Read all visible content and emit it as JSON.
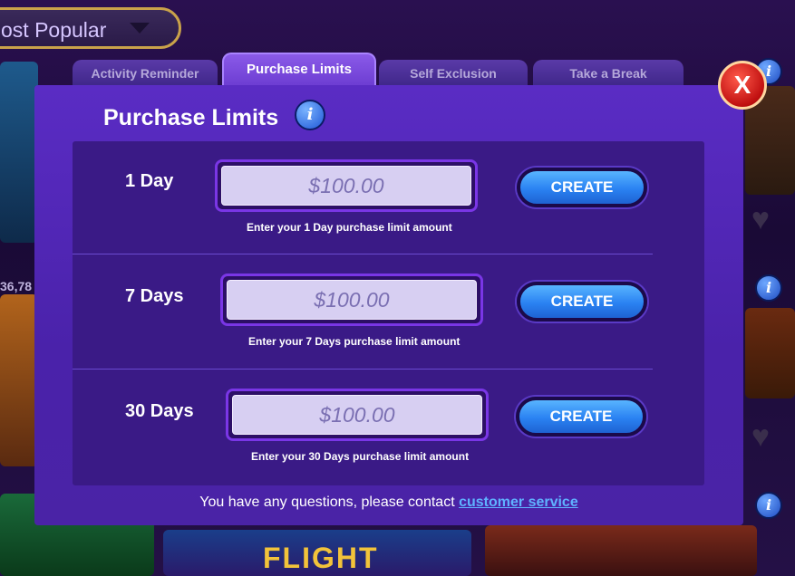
{
  "background": {
    "sort_label": "ost Popular",
    "partial_number": "36,78",
    "game_title_fragment": "FLIGHT"
  },
  "tabs": [
    {
      "label": "Activity Reminder",
      "active": false
    },
    {
      "label": "Purchase Limits",
      "active": true
    },
    {
      "label": "Self Exclusion",
      "active": false
    },
    {
      "label": "Take a Break",
      "active": false
    }
  ],
  "modal": {
    "title": "Purchase Limits",
    "close_label": "X",
    "rows": [
      {
        "label": "1 Day",
        "value": "$100.00",
        "hint": "Enter your 1 Day purchase limit amount",
        "button": "CREATE"
      },
      {
        "label": "7 Days",
        "value": "$100.00",
        "hint": "Enter your 7 Days purchase limit amount",
        "button": "CREATE"
      },
      {
        "label": "30 Days",
        "value": "$100.00",
        "hint": "Enter your 30 Days purchase limit amount",
        "button": "CREATE"
      }
    ],
    "footer_text": "You have any questions, please contact ",
    "footer_link": "customer service"
  },
  "icons": {
    "info": "i",
    "heart": "♥",
    "close": "X"
  },
  "colors": {
    "modal_bg": "#5a2cc4",
    "panel_bg": "#3a1a86",
    "create_button": "#2a82f2",
    "close_button": "#c01010",
    "link": "#5fb2ff"
  }
}
